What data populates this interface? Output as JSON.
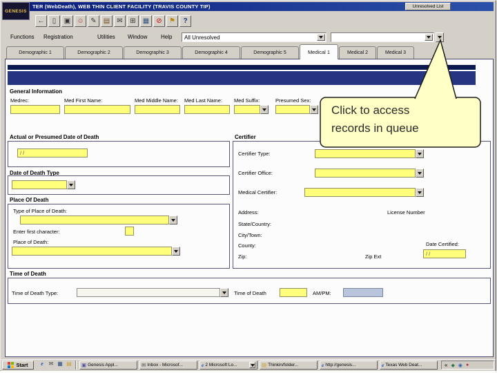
{
  "window": {
    "logo_text": "GENESIS",
    "title": "TER (WebDeath), WEB THIN CLIENT FACILITY (TRAVIS COUNTY TIP)",
    "unresolved_button": "Unresolved List"
  },
  "toolbar": {
    "icons": [
      {
        "name": "back-icon",
        "glyph": "←"
      },
      {
        "name": "new-document-icon",
        "glyph": "▯"
      },
      {
        "name": "copy-icon",
        "glyph": "▣"
      },
      {
        "name": "person-icon",
        "glyph": "☺"
      },
      {
        "name": "edit-icon",
        "glyph": "✎"
      },
      {
        "name": "books-icon",
        "glyph": "▤"
      },
      {
        "name": "mail-icon",
        "glyph": "✉"
      },
      {
        "name": "calculator-icon",
        "glyph": "⊞"
      },
      {
        "name": "chart-icon",
        "glyph": "▦"
      },
      {
        "name": "block-icon",
        "glyph": "⊘"
      },
      {
        "name": "flag-icon",
        "glyph": "⚑"
      },
      {
        "name": "help-icon",
        "glyph": "?"
      }
    ]
  },
  "menu": {
    "items": [
      "Functions",
      "Registration",
      "Utilities",
      "Window",
      "Help"
    ],
    "queue_filter_value": "All Unresolved",
    "search_value": ""
  },
  "tabs": [
    {
      "label": "Demographic 1"
    },
    {
      "label": "Demographic 2"
    },
    {
      "label": "Demographic 3"
    },
    {
      "label": "Demographic 4"
    },
    {
      "label": "Demographic 5"
    },
    {
      "label": "Medical 1",
      "active": true
    },
    {
      "label": "Medical 2"
    },
    {
      "label": "Medical 3"
    }
  ],
  "form": {
    "general": {
      "title": "General Information",
      "fields": [
        {
          "label": "Medrec:",
          "value": ""
        },
        {
          "label": "Med First Name:",
          "value": ""
        },
        {
          "label": "Med Middle Name:",
          "value": ""
        },
        {
          "label": "Med Last Name:",
          "value": ""
        },
        {
          "label": "Med Suffix:",
          "value": ""
        },
        {
          "label": "Presumed Sex:",
          "value": ""
        }
      ]
    },
    "date_of_death": {
      "title": "Actual or Presumed Date of Death",
      "value": "/  /"
    },
    "date_of_death_type": {
      "title": "Date of Death Type",
      "value": ""
    },
    "place_of_death": {
      "title": "Place Of Death",
      "type_label": "Type of Place of Death:",
      "type_value": "",
      "first_char_label": "Enter first character:",
      "first_char_value": "",
      "place_label": "Place of Death:",
      "place_value": ""
    },
    "certifier": {
      "title": "Certifier",
      "type_label": "Certifier Type:",
      "type_value": "",
      "office_label": "Certifier Office:",
      "office_value": "",
      "medical_label": "Medical Certifier:",
      "medical_value": "",
      "address_label": "Address:",
      "license_label": "License Number",
      "state_label": "State/Country:",
      "city_label": "City/Town:",
      "county_label": "County:",
      "zip_label": "Zip:",
      "zip_ext_label": "Zip Ext",
      "date_certified_label": "Date Certified:",
      "date_certified_value": "/  /"
    },
    "time_of_death": {
      "title": "Time of Death",
      "type_label": "Time of Death  Type:",
      "type_value": "",
      "time_label": "Time of Death",
      "time_value": "",
      "ampm_label": "AM/PM:",
      "ampm_value": ""
    }
  },
  "callout": {
    "line1": "Click to access",
    "line2": "records in queue"
  },
  "taskbar": {
    "start_label": "Start",
    "quick_launch": [
      {
        "name": "ie-icon",
        "glyph": "e"
      },
      {
        "name": "mail-icon",
        "glyph": "✉"
      },
      {
        "name": "desktop-icon",
        "glyph": "▦"
      },
      {
        "name": "folder-icon",
        "glyph": "▤"
      }
    ],
    "tasks": [
      {
        "label": "Genesis Appl...",
        "icon": "▣"
      },
      {
        "label": "Inbox - Microsof...",
        "icon": "✉"
      },
      {
        "label": "2 Microsoft Lo...",
        "icon": "e"
      },
      {
        "label": "Thinkin/folder...",
        "icon": "▤"
      },
      {
        "label": "http://genesis...",
        "icon": "e"
      },
      {
        "label": "Texas Web Deat...",
        "icon": "e"
      }
    ],
    "tray_icons": [
      {
        "name": "collapse-chevron-icon",
        "glyph": "«"
      },
      {
        "name": "network-icon",
        "glyph": "◆"
      },
      {
        "name": "volume-icon",
        "glyph": "◉"
      },
      {
        "name": "clock-icon",
        "glyph": "●"
      }
    ]
  }
}
